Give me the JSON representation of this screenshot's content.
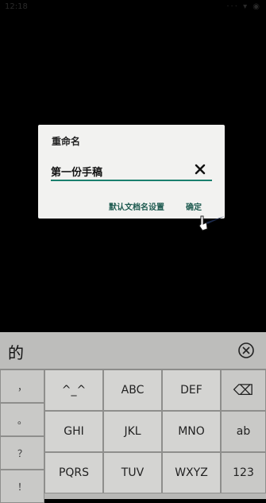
{
  "status_bar": {
    "time": "12:18",
    "icons": "··· ▾ ◉"
  },
  "dialog": {
    "title": "重命名",
    "input_value": "第一份手稿",
    "default_name_button": "默认文档名设置",
    "ok_button": "确定"
  },
  "keyboard": {
    "candidate": "的",
    "symbols": [
      "，",
      "。",
      "？",
      "！"
    ],
    "row1": [
      "^_^",
      "ABC",
      "DEF"
    ],
    "row2": [
      "GHI",
      "JKL",
      "MNO"
    ],
    "row3": [
      "PQRS",
      "TUV",
      "WXYZ"
    ],
    "right": [
      "⌫",
      "ab",
      "123"
    ]
  }
}
